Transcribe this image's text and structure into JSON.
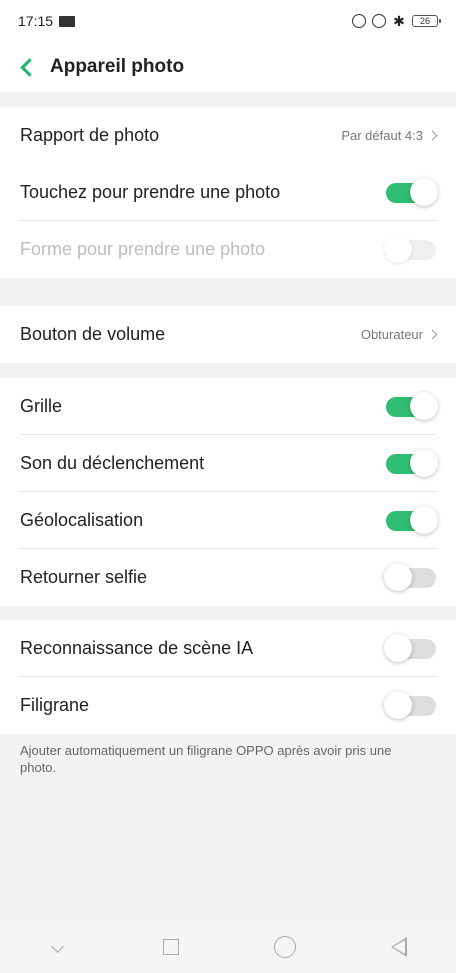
{
  "status_bar": {
    "time": "17:15",
    "battery_level": "26"
  },
  "header": {
    "title": "Appareil photo"
  },
  "sections": [
    {
      "rows": [
        {
          "label": "Rapport de photo",
          "value": "Par défaut 4:3",
          "type": "nav"
        },
        {
          "label": "Touchez pour prendre une photo",
          "type": "toggle",
          "state": "on"
        },
        {
          "label": "Forme pour prendre une photo",
          "type": "toggle",
          "state": "disabled"
        }
      ]
    },
    {
      "rows": [
        {
          "label": "Bouton de volume",
          "value": "Obturateur",
          "type": "nav"
        }
      ]
    },
    {
      "rows": [
        {
          "label": "Grille",
          "type": "toggle",
          "state": "on"
        },
        {
          "label": "Son du déclenchement",
          "type": "toggle",
          "state": "on"
        },
        {
          "label": "Géolocalisation",
          "type": "toggle",
          "state": "on"
        },
        {
          "label": "Retourner selfie",
          "type": "toggle",
          "state": "off"
        }
      ]
    },
    {
      "rows": [
        {
          "label": "Reconnaissance de scène IA",
          "type": "toggle",
          "state": "off"
        },
        {
          "label": "Filigrane",
          "type": "toggle",
          "state": "off"
        }
      ]
    }
  ],
  "filigrane_description": "Ajouter automatiquement un filigrane OPPO après avoir pris une photo.",
  "colors": {
    "accent": "#2ebd73",
    "back_arrow": "#1fb46a"
  }
}
